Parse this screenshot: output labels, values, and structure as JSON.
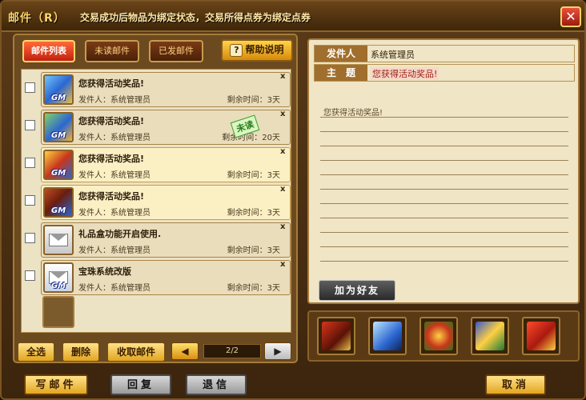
{
  "window": {
    "title": "邮件（R）",
    "notice": "交易成功后物品为绑定状态，交易所得点券为绑定点券",
    "close_icon": "✕"
  },
  "tabs": {
    "list": "邮件列表",
    "unread": "未读邮件",
    "sent": "已发邮件",
    "help": "帮助说明",
    "help_icon": "?"
  },
  "mails": [
    {
      "subject": "您获得活动奖品!",
      "sender": "发件人：系统管理员",
      "remaining": "剩余时间：3天",
      "thumb": "gm",
      "gm": "GM",
      "highlight": false
    },
    {
      "subject": "您获得活动奖品!",
      "sender": "发件人：系统管理员",
      "remaining": "剩余时间：20天",
      "thumb": "gm",
      "gm": "GM",
      "highlight": false,
      "badge": "未读"
    },
    {
      "subject": "您获得活动奖品!",
      "sender": "发件人：系统管理员",
      "remaining": "剩余时间：3天",
      "thumb": "gm",
      "gm": "GM",
      "highlight": true
    },
    {
      "subject": "您获得活动奖品!",
      "sender": "发件人：系统管理员",
      "remaining": "剩余时间：3天",
      "thumb": "gm",
      "gm": "GM",
      "highlight": true
    },
    {
      "subject": "礼品盒功能开启使用.",
      "sender": "发件人：系统管理员",
      "remaining": "剩余时间：3天",
      "thumb": "envelope",
      "highlight": false
    },
    {
      "subject": "宝珠系统改版",
      "sender": "发件人：系统管理员",
      "remaining": "剩余时间：3天",
      "thumb": "envelope-gm",
      "gm": "GM",
      "highlight": false
    }
  ],
  "delete_mark": "x",
  "list_actions": {
    "select_all": "全选",
    "delete": "删除",
    "collect": "收取邮件"
  },
  "pager": {
    "prev_icon": "◀",
    "next_icon": "▶",
    "text": "2/2"
  },
  "detail": {
    "sender_label": "发件人",
    "sender_value": "系统管理员",
    "subject_label": "主　题",
    "subject_value": "您获得活动奖品!",
    "body": "您获得活动奖品!",
    "add_friend": "加为好友"
  },
  "footer": {
    "write": "写邮件",
    "reply": "回复",
    "return": "退信",
    "cancel": "取消"
  },
  "colors": {
    "accent": "#ffd56a",
    "frame": "#5b3a17",
    "paper": "#f0e5c5"
  }
}
